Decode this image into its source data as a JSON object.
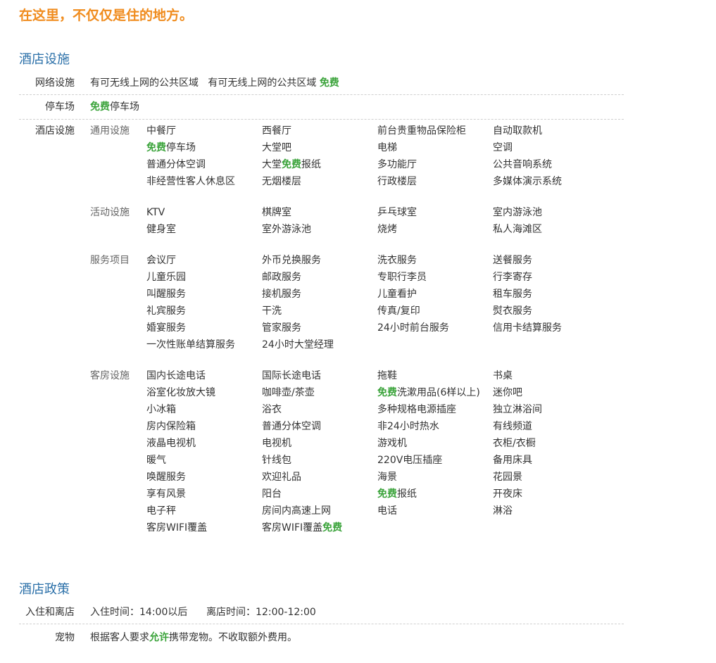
{
  "slogan": "在这里，不仅仅是住的地方。",
  "colors": {
    "orange": "#f08c1e",
    "blue": "#2a6fa8",
    "green": "#3aa33a"
  },
  "facilities": {
    "title": "酒店设施",
    "network": {
      "label": "网络设施",
      "text1": "有可无线上网的公共区域",
      "text2": "有可无线上网的公共区域",
      "free": "免费"
    },
    "parking": {
      "label": "停车场",
      "free": "免费",
      "text": "停车场"
    },
    "hotel_facilities_label": "酒店设施",
    "groups": [
      {
        "label": "通用设施",
        "items": [
          {
            "pre": "",
            "free": "",
            "post": "中餐厅"
          },
          {
            "pre": "",
            "free": "",
            "post": "西餐厅"
          },
          {
            "pre": "",
            "free": "",
            "post": "前台贵重物品保险柜"
          },
          {
            "pre": "",
            "free": "",
            "post": "自动取款机"
          },
          {
            "pre": "",
            "free": "免费",
            "post": "停车场"
          },
          {
            "pre": "",
            "free": "",
            "post": "大堂吧"
          },
          {
            "pre": "",
            "free": "",
            "post": "电梯"
          },
          {
            "pre": "",
            "free": "",
            "post": "空调"
          },
          {
            "pre": "",
            "free": "",
            "post": "普通分体空调"
          },
          {
            "pre": "大堂",
            "free": "免费",
            "post": "报纸"
          },
          {
            "pre": "",
            "free": "",
            "post": "多功能厅"
          },
          {
            "pre": "",
            "free": "",
            "post": "公共音响系统"
          },
          {
            "pre": "",
            "free": "",
            "post": "非经营性客人休息区"
          },
          {
            "pre": "",
            "free": "",
            "post": "无烟楼层"
          },
          {
            "pre": "",
            "free": "",
            "post": "行政楼层"
          },
          {
            "pre": "",
            "free": "",
            "post": "多媒体演示系统"
          }
        ]
      },
      {
        "label": "活动设施",
        "items": [
          {
            "pre": "",
            "free": "",
            "post": "KTV"
          },
          {
            "pre": "",
            "free": "",
            "post": "棋牌室"
          },
          {
            "pre": "",
            "free": "",
            "post": "乒乓球室"
          },
          {
            "pre": "",
            "free": "",
            "post": "室内游泳池"
          },
          {
            "pre": "",
            "free": "",
            "post": "健身室"
          },
          {
            "pre": "",
            "free": "",
            "post": "室外游泳池"
          },
          {
            "pre": "",
            "free": "",
            "post": "烧烤"
          },
          {
            "pre": "",
            "free": "",
            "post": "私人海滩区"
          }
        ]
      },
      {
        "label": "服务项目",
        "items": [
          {
            "pre": "",
            "free": "",
            "post": "会议厅"
          },
          {
            "pre": "",
            "free": "",
            "post": "外币兑换服务"
          },
          {
            "pre": "",
            "free": "",
            "post": "洗衣服务"
          },
          {
            "pre": "",
            "free": "",
            "post": "送餐服务"
          },
          {
            "pre": "",
            "free": "",
            "post": "儿童乐园"
          },
          {
            "pre": "",
            "free": "",
            "post": "邮政服务"
          },
          {
            "pre": "",
            "free": "",
            "post": "专职行李员"
          },
          {
            "pre": "",
            "free": "",
            "post": "行李寄存"
          },
          {
            "pre": "",
            "free": "",
            "post": "叫醒服务"
          },
          {
            "pre": "",
            "free": "",
            "post": "接机服务"
          },
          {
            "pre": "",
            "free": "",
            "post": "儿童看护"
          },
          {
            "pre": "",
            "free": "",
            "post": "租车服务"
          },
          {
            "pre": "",
            "free": "",
            "post": "礼宾服务"
          },
          {
            "pre": "",
            "free": "",
            "post": "干洗"
          },
          {
            "pre": "",
            "free": "",
            "post": "传真/复印"
          },
          {
            "pre": "",
            "free": "",
            "post": "熨衣服务"
          },
          {
            "pre": "",
            "free": "",
            "post": "婚宴服务"
          },
          {
            "pre": "",
            "free": "",
            "post": "管家服务"
          },
          {
            "pre": "",
            "free": "",
            "post": "24小时前台服务"
          },
          {
            "pre": "",
            "free": "",
            "post": "信用卡结算服务"
          },
          {
            "pre": "",
            "free": "",
            "post": "一次性账单结算服务"
          },
          {
            "pre": "",
            "free": "",
            "post": "24小时大堂经理"
          }
        ]
      },
      {
        "label": "客房设施",
        "items": [
          {
            "pre": "",
            "free": "",
            "post": "国内长途电话"
          },
          {
            "pre": "",
            "free": "",
            "post": "国际长途电话"
          },
          {
            "pre": "",
            "free": "",
            "post": "拖鞋"
          },
          {
            "pre": "",
            "free": "",
            "post": "书桌"
          },
          {
            "pre": "",
            "free": "",
            "post": "浴室化妆放大镜"
          },
          {
            "pre": "",
            "free": "",
            "post": "咖啡壶/茶壶"
          },
          {
            "pre": "",
            "free": "免费",
            "post": "洗漱用品(6样以上)"
          },
          {
            "pre": "",
            "free": "",
            "post": "迷你吧"
          },
          {
            "pre": "",
            "free": "",
            "post": "小冰箱"
          },
          {
            "pre": "",
            "free": "",
            "post": "浴衣"
          },
          {
            "pre": "",
            "free": "",
            "post": "多种规格电源插座"
          },
          {
            "pre": "",
            "free": "",
            "post": "独立淋浴间"
          },
          {
            "pre": "",
            "free": "",
            "post": "房内保险箱"
          },
          {
            "pre": "",
            "free": "",
            "post": "普通分体空调"
          },
          {
            "pre": "",
            "free": "",
            "post": "非24小时热水"
          },
          {
            "pre": "",
            "free": "",
            "post": "有线频道"
          },
          {
            "pre": "",
            "free": "",
            "post": "液晶电视机"
          },
          {
            "pre": "",
            "free": "",
            "post": "电视机"
          },
          {
            "pre": "",
            "free": "",
            "post": "游戏机"
          },
          {
            "pre": "",
            "free": "",
            "post": "衣柜/衣橱"
          },
          {
            "pre": "",
            "free": "",
            "post": "暖气"
          },
          {
            "pre": "",
            "free": "",
            "post": "针线包"
          },
          {
            "pre": "",
            "free": "",
            "post": "220V电压插座"
          },
          {
            "pre": "",
            "free": "",
            "post": "备用床具"
          },
          {
            "pre": "",
            "free": "",
            "post": "唤醒服务"
          },
          {
            "pre": "",
            "free": "",
            "post": "欢迎礼品"
          },
          {
            "pre": "",
            "free": "",
            "post": "海景"
          },
          {
            "pre": "",
            "free": "",
            "post": "花园景"
          },
          {
            "pre": "",
            "free": "",
            "post": "享有风景"
          },
          {
            "pre": "",
            "free": "",
            "post": "阳台"
          },
          {
            "pre": "",
            "free": "免费",
            "post": "报纸"
          },
          {
            "pre": "",
            "free": "",
            "post": "开夜床"
          },
          {
            "pre": "",
            "free": "",
            "post": "电子秤"
          },
          {
            "pre": "",
            "free": "",
            "post": "房间内高速上网"
          },
          {
            "pre": "",
            "free": "",
            "post": "电话"
          },
          {
            "pre": "",
            "free": "",
            "post": "淋浴"
          },
          {
            "pre": "",
            "free": "",
            "post": "客房WIFI覆盖"
          },
          {
            "pre": "客房WIFI覆盖",
            "free": "免费",
            "post": ""
          }
        ]
      }
    ]
  },
  "policy": {
    "title": "酒店政策",
    "checkin": {
      "label": "入住和离店",
      "checkin_text": "入住时间：14:00以后",
      "checkout_text": "离店时间：12:00-12:00"
    },
    "pets": {
      "label": "宠物",
      "pre": "根据客人要求",
      "highlight": "允许",
      "post": "携带宠物。不收取额外费用。"
    }
  }
}
